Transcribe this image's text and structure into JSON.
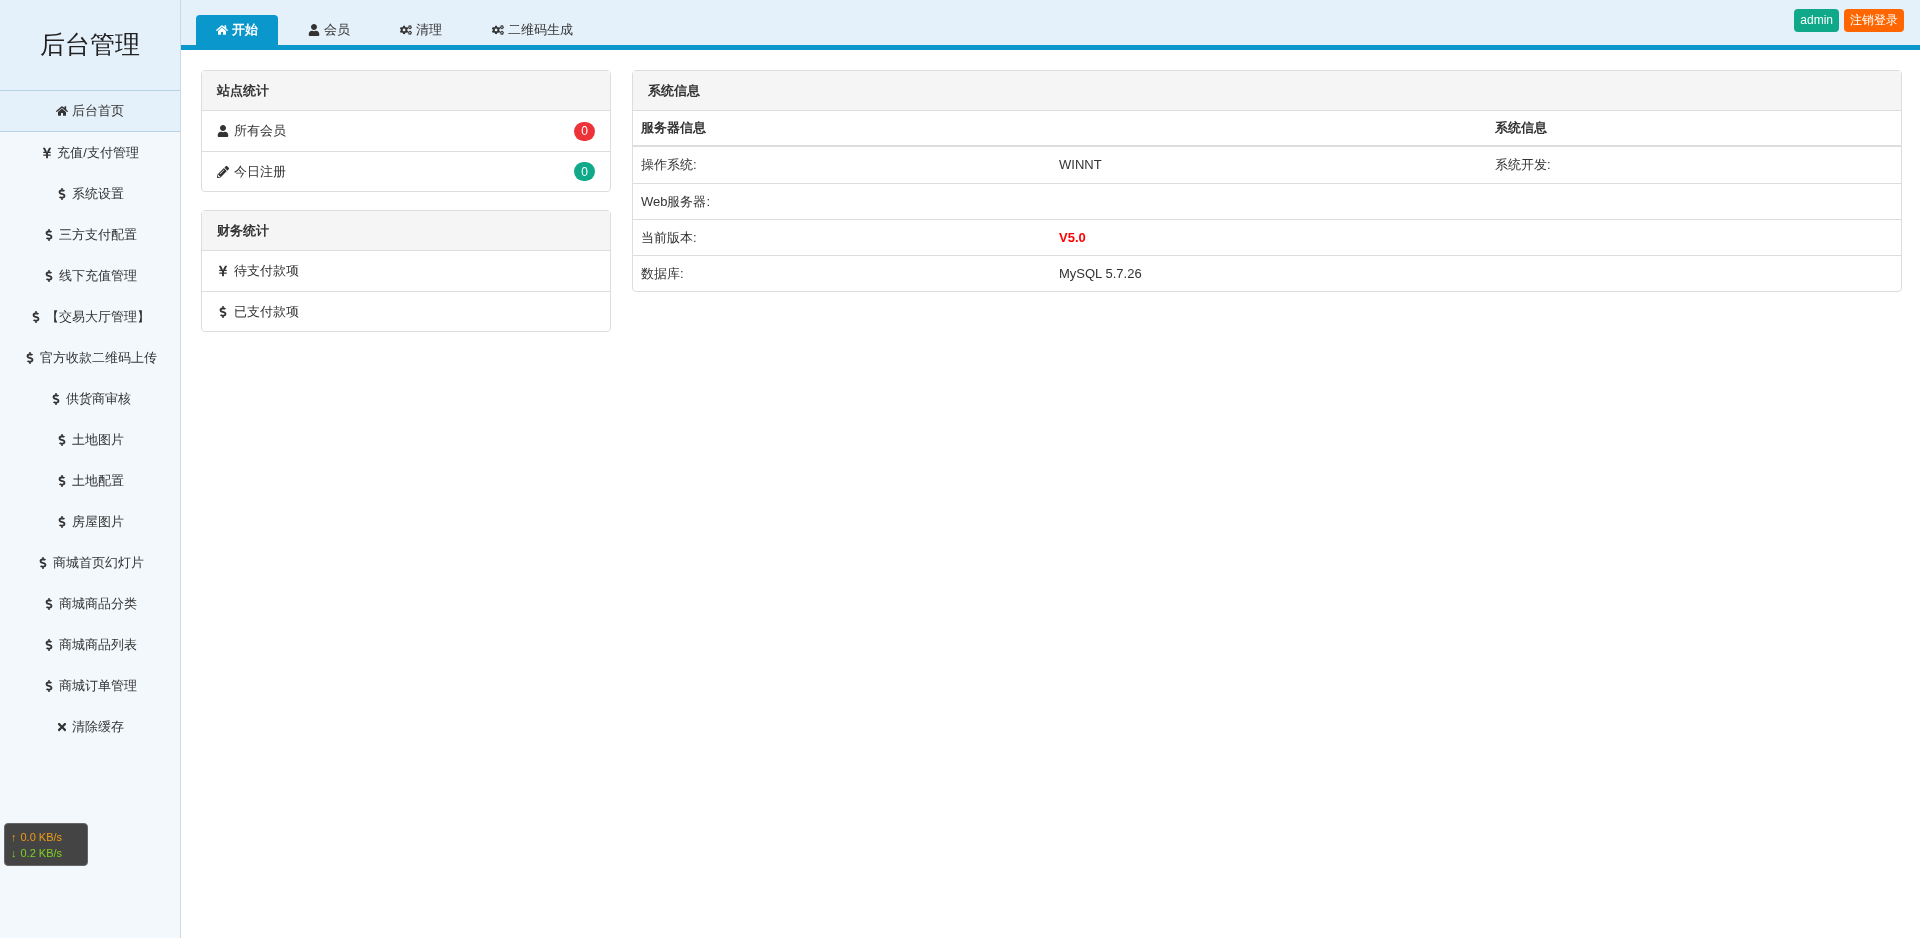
{
  "sidebar": {
    "title": "后台管理",
    "items": [
      {
        "kind": "home",
        "label": "后台首页",
        "selected": true
      },
      {
        "kind": "yen",
        "label": "充值/支付管理",
        "selected": false
      },
      {
        "kind": "dollar",
        "label": "系统设置",
        "selected": false
      },
      {
        "kind": "dollar",
        "label": "三方支付配置",
        "selected": false
      },
      {
        "kind": "dollar",
        "label": "线下充值管理",
        "selected": false
      },
      {
        "kind": "dollar",
        "label": "【交易大厅管理】",
        "selected": false
      },
      {
        "kind": "dollar",
        "label": "官方收款二维码上传",
        "selected": false
      },
      {
        "kind": "dollar",
        "label": "供货商审核",
        "selected": false
      },
      {
        "kind": "dollar",
        "label": "土地图片",
        "selected": false
      },
      {
        "kind": "dollar",
        "label": "土地配置",
        "selected": false
      },
      {
        "kind": "dollar",
        "label": "房屋图片",
        "selected": false
      },
      {
        "kind": "dollar",
        "label": "商城首页幻灯片",
        "selected": false
      },
      {
        "kind": "dollar",
        "label": "商城商品分类",
        "selected": false
      },
      {
        "kind": "dollar",
        "label": "商城商品列表",
        "selected": false
      },
      {
        "kind": "dollar",
        "label": "商城订单管理",
        "selected": false
      },
      {
        "kind": "clear",
        "label": "清除缓存",
        "selected": false
      }
    ]
  },
  "tabs": [
    {
      "kind": "home",
      "label": "开始",
      "selected": true
    },
    {
      "kind": "user",
      "label": "会员",
      "selected": false
    },
    {
      "kind": "tools",
      "label": "清理",
      "selected": false
    },
    {
      "kind": "tools",
      "label": "二维码生成",
      "selected": false
    }
  ],
  "user_buttons": [
    {
      "label": "admin",
      "color": "#0fa98a"
    },
    {
      "label": "注销登录",
      "color": "#ff6600"
    }
  ],
  "site_stats": {
    "title": "站点统计",
    "rows": [
      {
        "kind": "user",
        "label": "所有会员",
        "count": "0",
        "color": "#ee3338"
      },
      {
        "kind": "edit",
        "label": "今日注册",
        "count": "0",
        "color": "#10a98a"
      }
    ]
  },
  "finance_stats": {
    "title": "财务统计",
    "rows": [
      {
        "kind": "yen",
        "label": "待支付款项"
      },
      {
        "kind": "dollar",
        "label": "已支付款项"
      }
    ]
  },
  "system_info": {
    "title": "系统信息",
    "columns": [
      "服务器信息",
      "",
      "系统信息"
    ],
    "rows": [
      {
        "kind": "plain",
        "label": "操作系统:",
        "value": "WINNT",
        "extra": "系统开发:"
      },
      {
        "kind": "plain",
        "label": "Web服务器:"
      },
      {
        "kind": "emphasis",
        "label": "当前版本:",
        "value": "V5.0"
      },
      {
        "kind": "plain",
        "label": "数据库:",
        "value": "MySQL 5.7.26"
      }
    ]
  },
  "net_monitor": [
    {
      "arrow": "↑",
      "text": "0.0 KB/s"
    },
    {
      "arrow": "↓",
      "text": "0.2 KB/s"
    }
  ]
}
